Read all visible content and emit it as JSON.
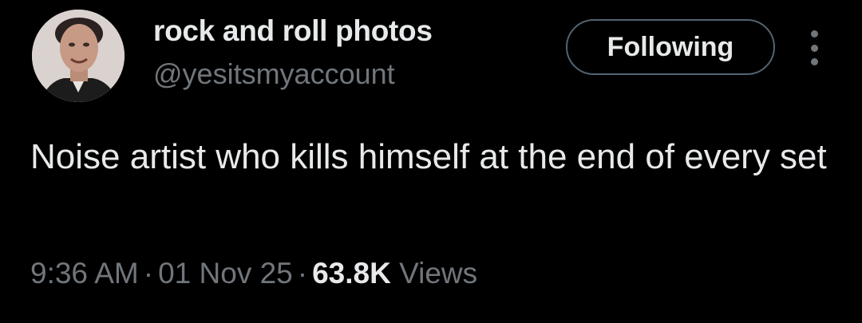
{
  "user": {
    "display_name": "rock and roll photos",
    "handle": "@yesitsmyaccount"
  },
  "actions": {
    "follow_label": "Following",
    "more_icon": "more-vertical-icon"
  },
  "tweet": {
    "text": "Noise artist who kills himself at the end of every set",
    "time": "9:36 AM",
    "separator": "·",
    "date": "01 Nov 25",
    "views_count": "63.8K",
    "views_label": "Views"
  },
  "colors": {
    "background": "#000000",
    "primary_text": "#e7e9ea",
    "secondary_text": "#71767b",
    "button_border": "#536471"
  }
}
